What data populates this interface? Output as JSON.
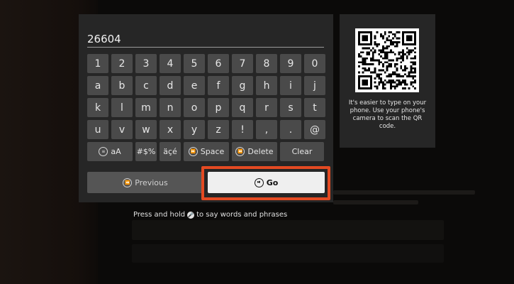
{
  "search": {
    "value": "26604"
  },
  "keyboard": {
    "row1": [
      "1",
      "2",
      "3",
      "4",
      "5",
      "6",
      "7",
      "8",
      "9",
      "0"
    ],
    "row2": [
      "a",
      "b",
      "c",
      "d",
      "e",
      "f",
      "g",
      "h",
      "i",
      "j"
    ],
    "row3": [
      "k",
      "l",
      "m",
      "n",
      "o",
      "p",
      "q",
      "r",
      "s",
      "t"
    ],
    "row4": [
      "u",
      "v",
      "w",
      "x",
      "y",
      "z",
      "!",
      ",",
      ".",
      "@"
    ],
    "func": {
      "case_label": "aA",
      "symbols_label": "#$%",
      "accents_label": "äçé",
      "space_label": "Space",
      "delete_label": "Delete",
      "clear_label": "Clear"
    },
    "previous_label": "Previous",
    "go_label": "Go"
  },
  "hint": {
    "before": "Press and hold",
    "after": "to say words and phrases"
  },
  "qr": {
    "text": "It's easier to type on your phone. Use your phone's camera to scan the QR code."
  },
  "colors": {
    "highlight": "#e44a22",
    "panel": "#262626",
    "key": "#4a4a4a"
  }
}
